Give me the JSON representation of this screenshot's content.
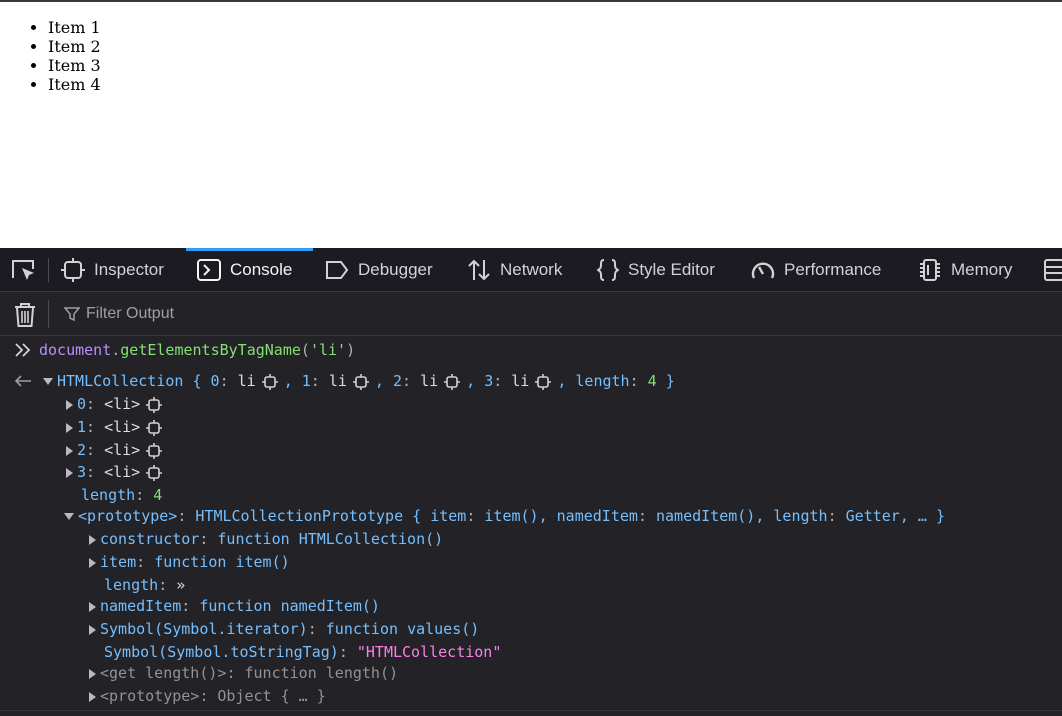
{
  "page": {
    "list_items": [
      "Item 1",
      "Item 2",
      "Item 3",
      "Item 4"
    ]
  },
  "devtools": {
    "tabs": {
      "inspector": "Inspector",
      "console": "Console",
      "debugger": "Debugger",
      "network": "Network",
      "style_editor": "Style Editor",
      "performance": "Performance",
      "memory": "Memory"
    },
    "selected_tab": "console",
    "accent_color": "#2a9dff",
    "filter_placeholder": "Filter Output",
    "console": {
      "input": {
        "obj": "document",
        "dot": ".",
        "method": "getElementsByTagName",
        "open": "(",
        "arg": "'li'",
        "close": ")"
      },
      "result": {
        "type": "HTMLCollection",
        "summary_open": "{",
        "k0": "0",
        "k1": "1",
        "k2": "2",
        "k3": "3",
        "li": "li",
        "colon": ":",
        "comma": ",",
        "length_key": "length",
        "length_val": "4",
        "summary_close": "}"
      },
      "entries": [
        {
          "key": "0",
          "tag": "<li>"
        },
        {
          "key": "1",
          "tag": "<li>"
        },
        {
          "key": "2",
          "tag": "<li>"
        },
        {
          "key": "3",
          "tag": "<li>"
        }
      ],
      "length_row": {
        "key": "length",
        "value": "4"
      },
      "prototype": {
        "key": "<prototype>",
        "type": "HTMLCollectionPrototype",
        "summary": "{ item: item(), namedItem: namedItem(), length: Getter, … }",
        "s_item_key": "item",
        "s_item_val": "item()",
        "s_named_key": "namedItem",
        "s_named_val": "namedItem()",
        "s_length_key": "length",
        "s_length_val": "Getter",
        "s_more": "… }",
        "s_open": "{"
      },
      "proto_rows": [
        {
          "key": "constructor",
          "kind": "function",
          "value": "HTMLCollection()",
          "expandable": true
        },
        {
          "key": "item",
          "kind": "function",
          "value": "item()",
          "expandable": true
        },
        {
          "key": "length",
          "kind": "",
          "value": "»",
          "expandable": false
        },
        {
          "key": "namedItem",
          "kind": "function",
          "value": "namedItem()",
          "expandable": true
        },
        {
          "key": "Symbol(Symbol.iterator)",
          "kind": "function",
          "value": "values()",
          "expandable": true
        },
        {
          "key": "Symbol(Symbol.toStringTag)",
          "kind": "",
          "value": "\"HTMLCollection\"",
          "expandable": false
        }
      ],
      "getter_row": {
        "key": "<get length()>",
        "kind": "function",
        "value": "length()"
      },
      "proto_proto_row": {
        "key": "<prototype>",
        "value": "Object { … }"
      }
    }
  }
}
